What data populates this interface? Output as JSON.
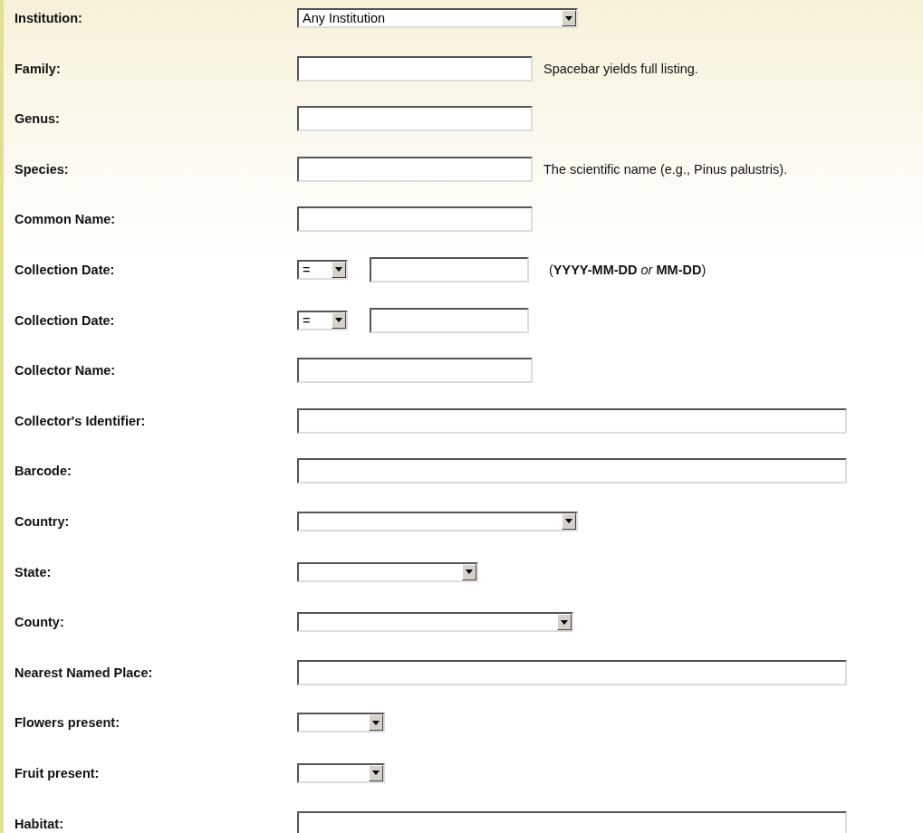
{
  "fields": [
    {
      "label": "Institution:",
      "kind": "select",
      "value": "Any Institution"
    },
    {
      "label": "Family:",
      "kind": "text",
      "hint": "Spacebar yields full listing."
    },
    {
      "label": "Genus:",
      "kind": "text"
    },
    {
      "label": "Species:",
      "kind": "text",
      "hint": "The scientific name (e.g., Pinus palustris)."
    },
    {
      "label": "Common Name:",
      "kind": "text"
    },
    {
      "label": "Collection Date:",
      "kind": "date",
      "operator": "=",
      "hint": "(**YYYY-MM-DD** *or* **MM-DD**)"
    },
    {
      "label": "Collection Date:",
      "kind": "date",
      "operator": "="
    },
    {
      "label": "Collector Name:",
      "kind": "text"
    },
    {
      "label": "Collector's Identifier:",
      "kind": "text"
    },
    {
      "label": "Barcode:",
      "kind": "text"
    },
    {
      "label": "Country:",
      "kind": "select"
    },
    {
      "label": "State:",
      "kind": "select"
    },
    {
      "label": "County:",
      "kind": "select"
    },
    {
      "label": "Nearest Named Place:",
      "kind": "text"
    },
    {
      "label": "Flowers present:",
      "kind": "select"
    },
    {
      "label": "Fruit present:",
      "kind": "select"
    },
    {
      "label": "Habitat:",
      "kind": "text"
    }
  ]
}
